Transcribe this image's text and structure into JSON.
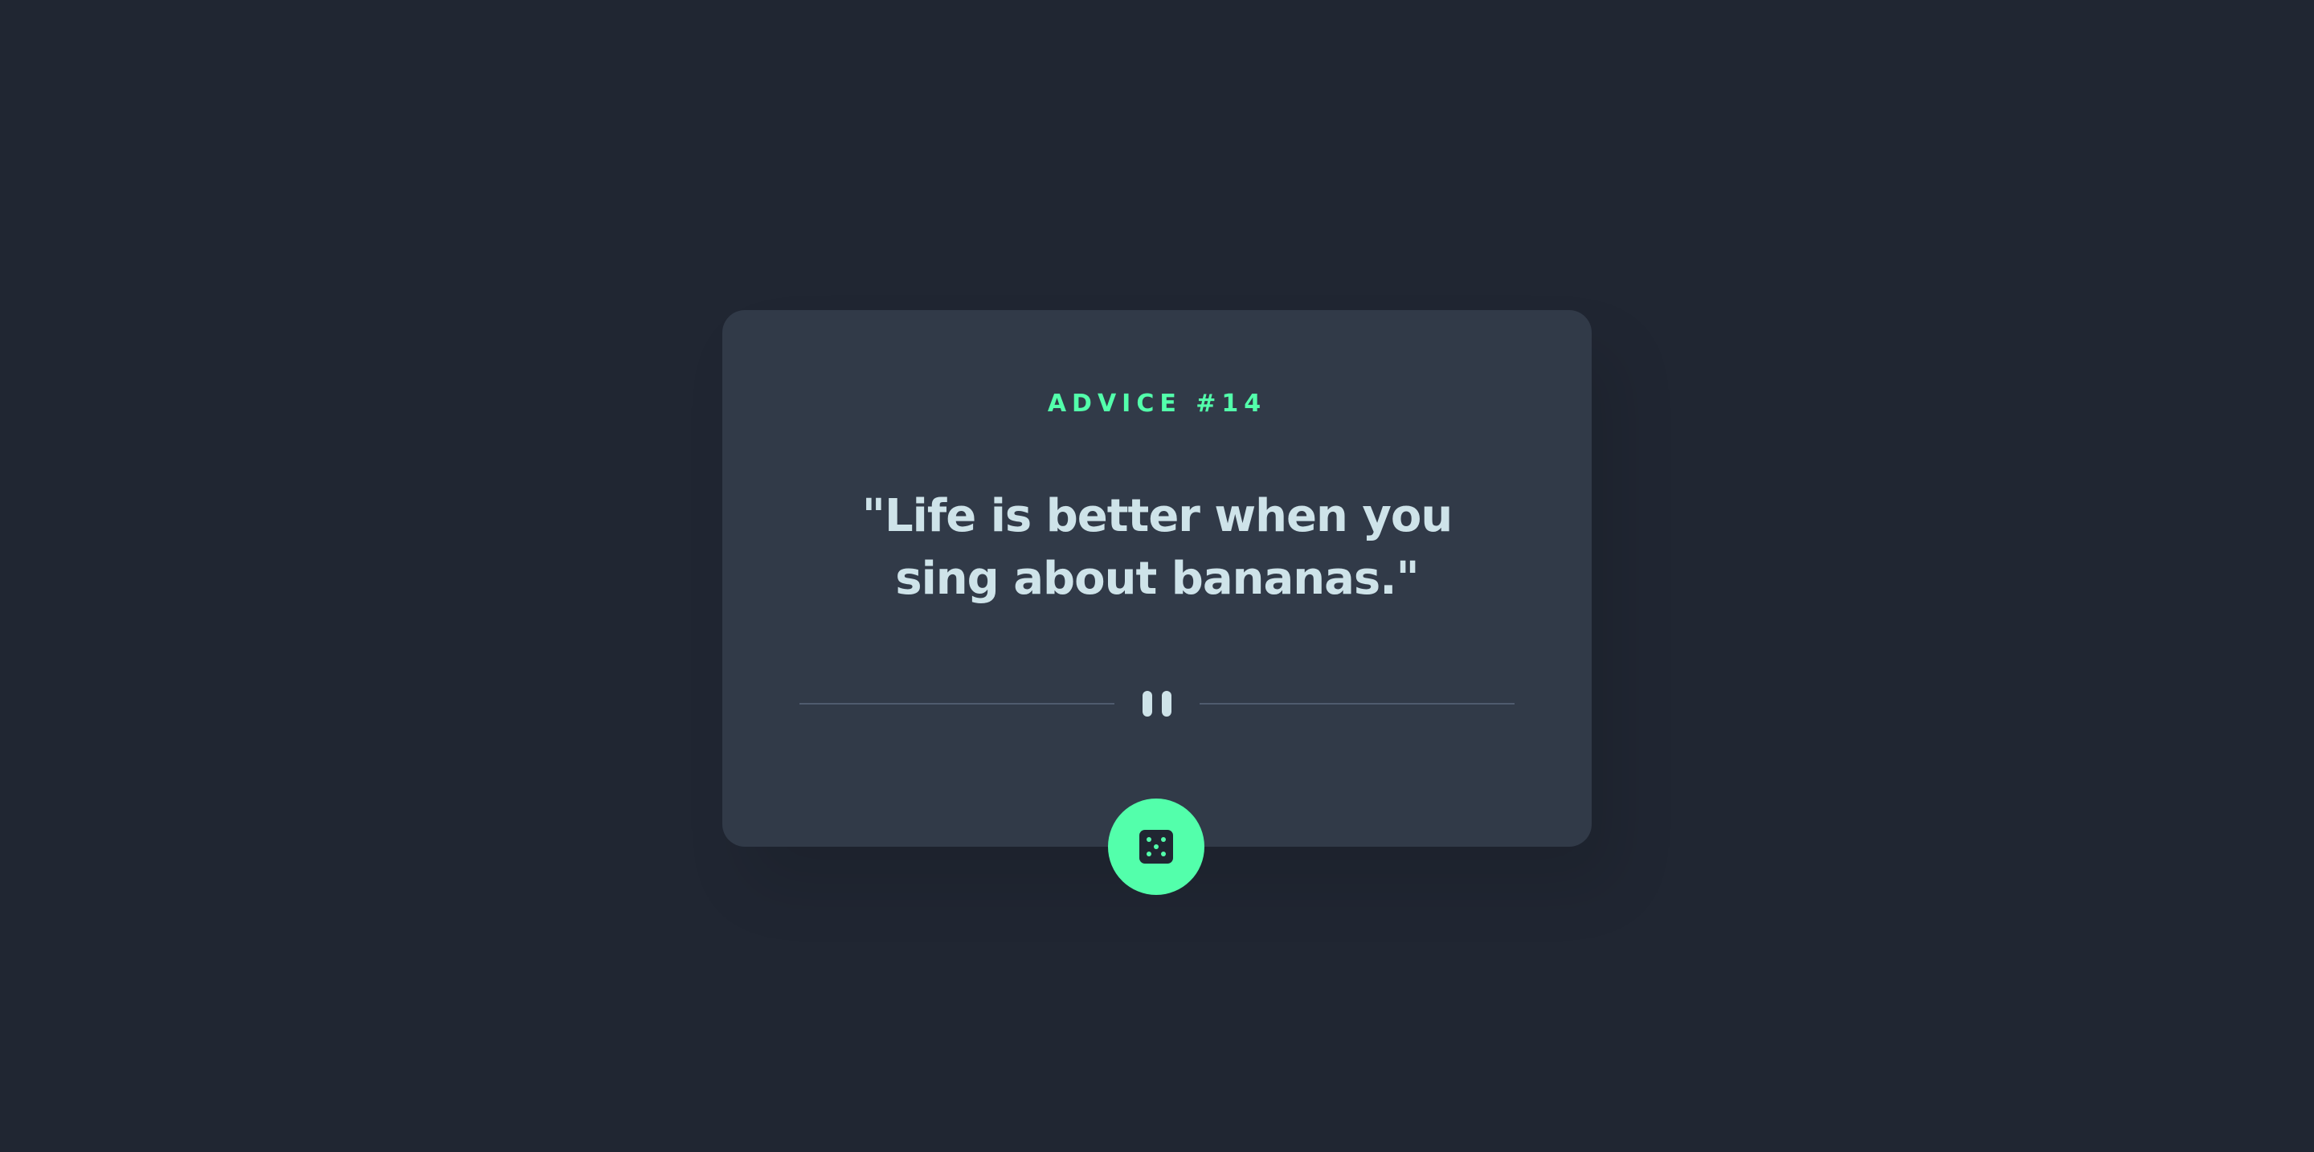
{
  "advice": {
    "label": "ADVICE #14",
    "text": "\"Life is better when you sing about bananas.\""
  },
  "divider": {
    "icon": "pause-icon"
  },
  "action": {
    "icon": "dice-icon"
  },
  "colors": {
    "background": "#202632",
    "card": "#313a48",
    "accent": "#53ffab",
    "text": "#cee3e9",
    "divider": "#4f5b6e"
  }
}
